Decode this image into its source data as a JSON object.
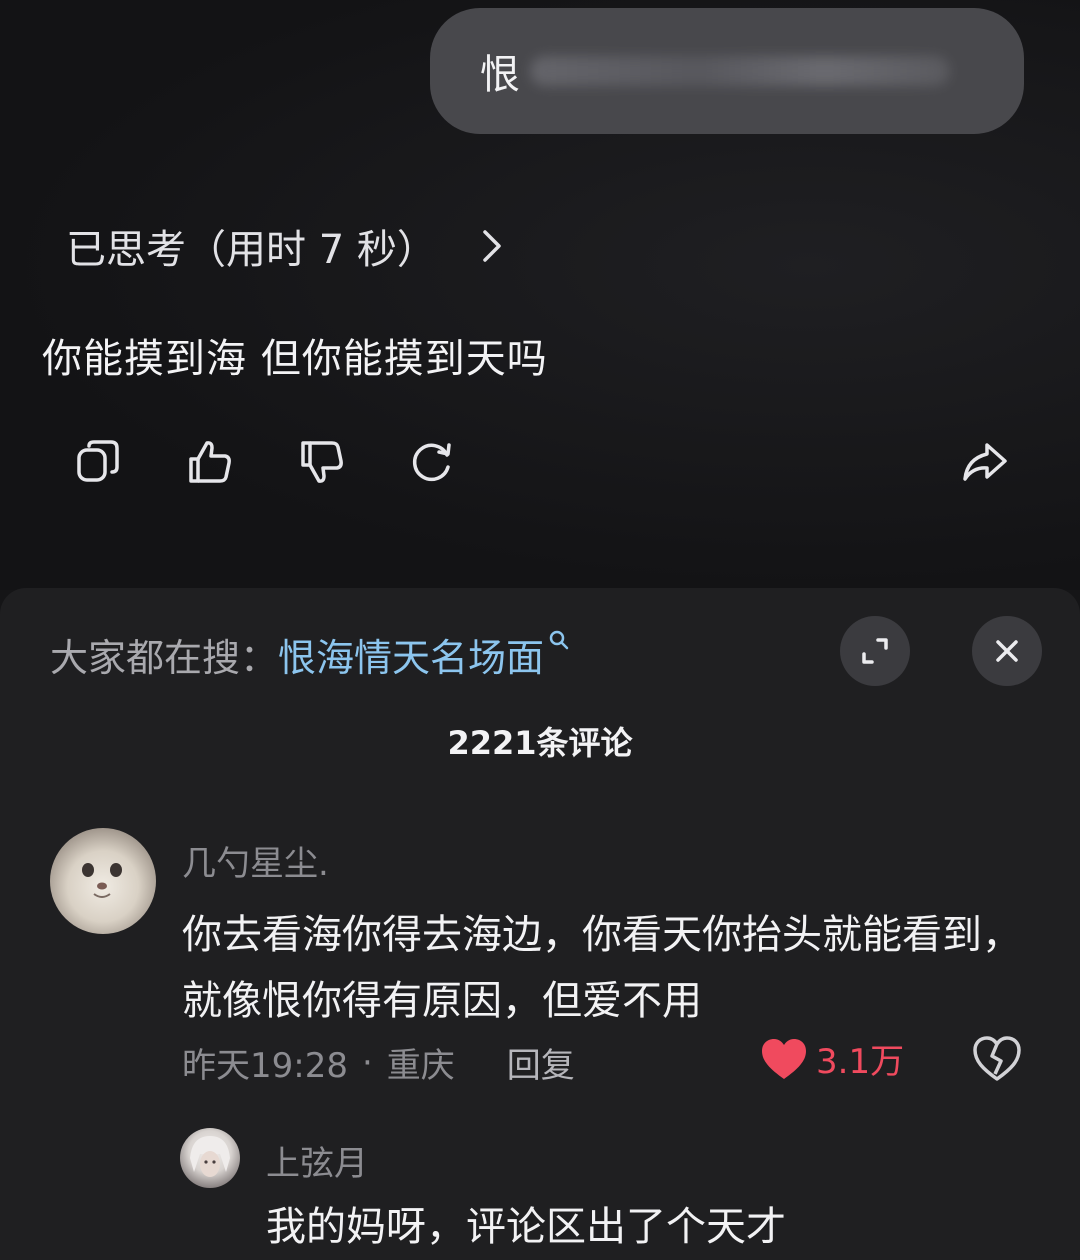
{
  "chat": {
    "user_message_visible": "恨",
    "thinking_label": "已思考（用时 7 秒）",
    "answer": "你能摸到海 但你能摸到天吗",
    "actions": [
      {
        "name": "copy-icon"
      },
      {
        "name": "thumbs-up-icon"
      },
      {
        "name": "thumbs-down-icon"
      },
      {
        "name": "regenerate-icon"
      },
      {
        "name": "share-icon"
      }
    ]
  },
  "comments_sheet": {
    "search_label": "大家都在搜：",
    "search_term": "恨海情天名场面",
    "comment_count": "2221条评论",
    "comments": [
      {
        "user": "几勺星尘.",
        "text": "你去看海你得去海边，你看天你抬头就能看到，就像恨你得有原因，但爱不用",
        "time": "昨天19:28",
        "separator": "·",
        "location": "重庆",
        "reply_label": "回复",
        "likes": "3.1万",
        "liked": true,
        "like_color": "#f04a5e"
      }
    ],
    "reply": {
      "user": "上弦月",
      "text": "我的妈呀，评论区出了个天才"
    }
  },
  "colors": {
    "background": "#151517",
    "sheet": "#1f1f21",
    "search_term": "#8cc5ee",
    "bubble": "#48484c"
  }
}
